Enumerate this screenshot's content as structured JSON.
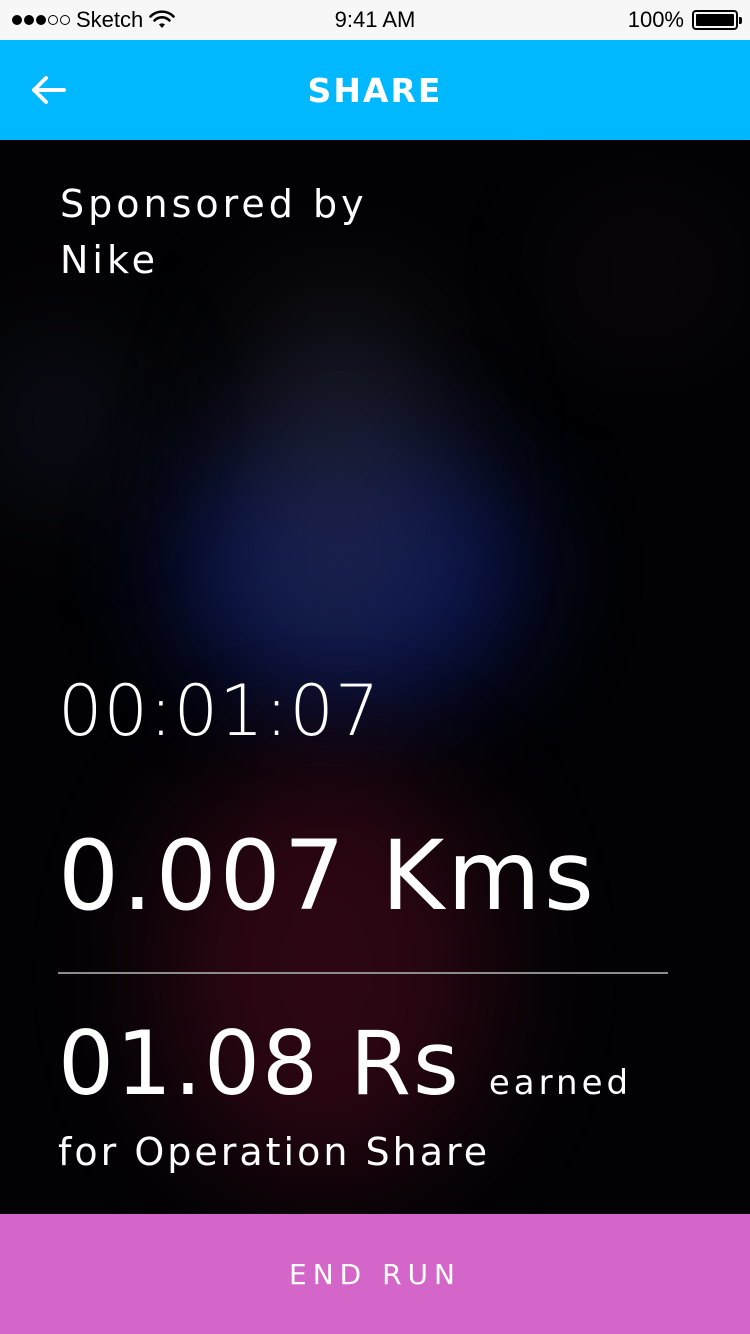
{
  "status_bar": {
    "carrier": "Sketch",
    "time": "9:41 AM",
    "battery": "100%",
    "signal_filled": 3,
    "signal_total": 5
  },
  "nav": {
    "title": "SHARE",
    "back_icon": "arrow-left-icon",
    "background_color": "#00b8ff"
  },
  "sponsor": {
    "line1": "Sponsored by",
    "line2": "Nike"
  },
  "stats": {
    "timer": "00:01:07",
    "distance": "0.007 Kms",
    "earned_amount": "01.08 Rs",
    "earned_label": "earned",
    "cause": "for Operation Share"
  },
  "footer": {
    "end_run_label": "END RUN",
    "background_color": "#d465c9"
  }
}
